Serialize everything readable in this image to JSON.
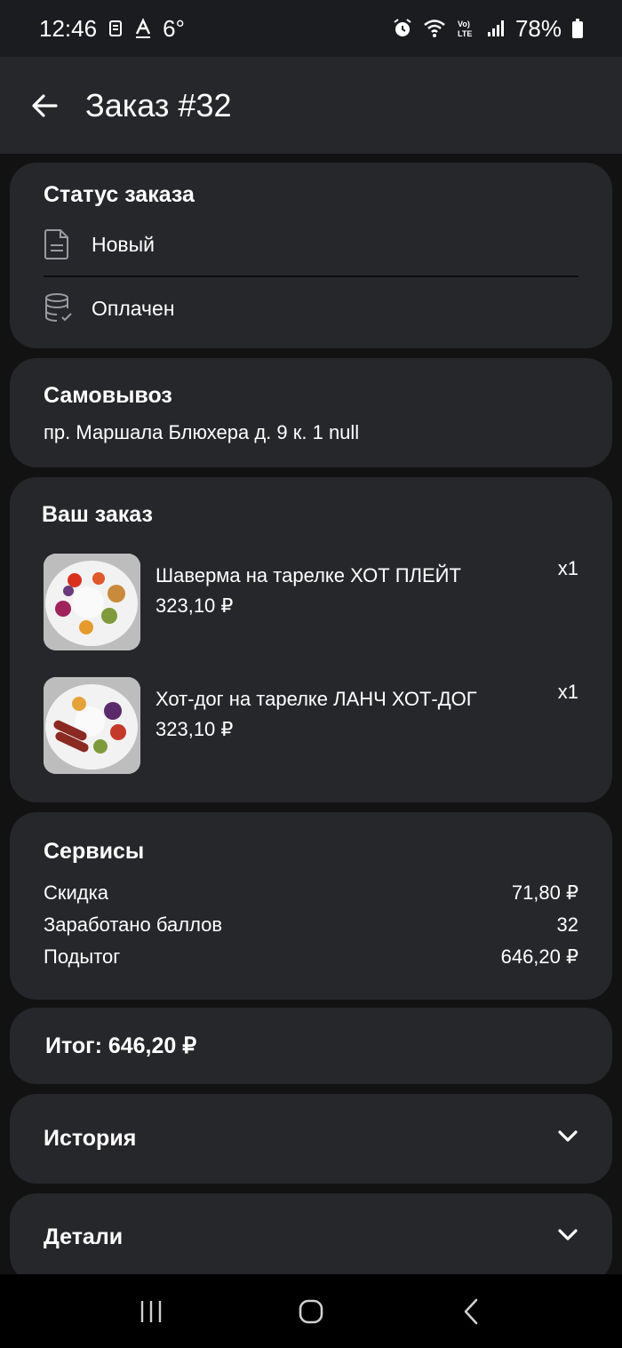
{
  "status_bar": {
    "time": "12:46",
    "temperature": "6°",
    "battery": "78%",
    "icons": [
      "notification-icon",
      "font-a-icon",
      "alarm-icon",
      "wifi-icon",
      "volte-icon",
      "signal-icon",
      "battery-icon"
    ]
  },
  "app_bar": {
    "title": "Заказ #32"
  },
  "status_card": {
    "title": "Статус заказа",
    "rows": [
      {
        "icon": "document-icon",
        "label": "Новый"
      },
      {
        "icon": "database-check-icon",
        "label": "Оплачен"
      }
    ]
  },
  "pickup_card": {
    "title": "Самовывоз",
    "address": "пр. Маршала Блюхера д. 9 к. 1 null"
  },
  "order_card": {
    "title": "Ваш заказ",
    "items": [
      {
        "name": "Шаверма на тарелке ХОТ ПЛЕЙТ",
        "price": "323,10 ₽",
        "qty": "x1"
      },
      {
        "name": "Хот-дог на тарелке ЛАНЧ ХОТ-ДОГ",
        "price": "323,10 ₽",
        "qty": "x1"
      }
    ]
  },
  "services_card": {
    "title": "Сервисы",
    "rows": [
      {
        "label": "Скидка",
        "value": "71,80 ₽"
      },
      {
        "label": "Заработано баллов",
        "value": "32"
      },
      {
        "label": "Подытог",
        "value": "646,20 ₽"
      }
    ]
  },
  "total_card": {
    "label": "Итог: 646,20 ₽"
  },
  "history_section": {
    "label": "История"
  },
  "details_section": {
    "label": "Детали"
  },
  "colors": {
    "background": "#121212",
    "card": "#26272b",
    "appbar": "#26272b",
    "text": "#ffffff"
  }
}
